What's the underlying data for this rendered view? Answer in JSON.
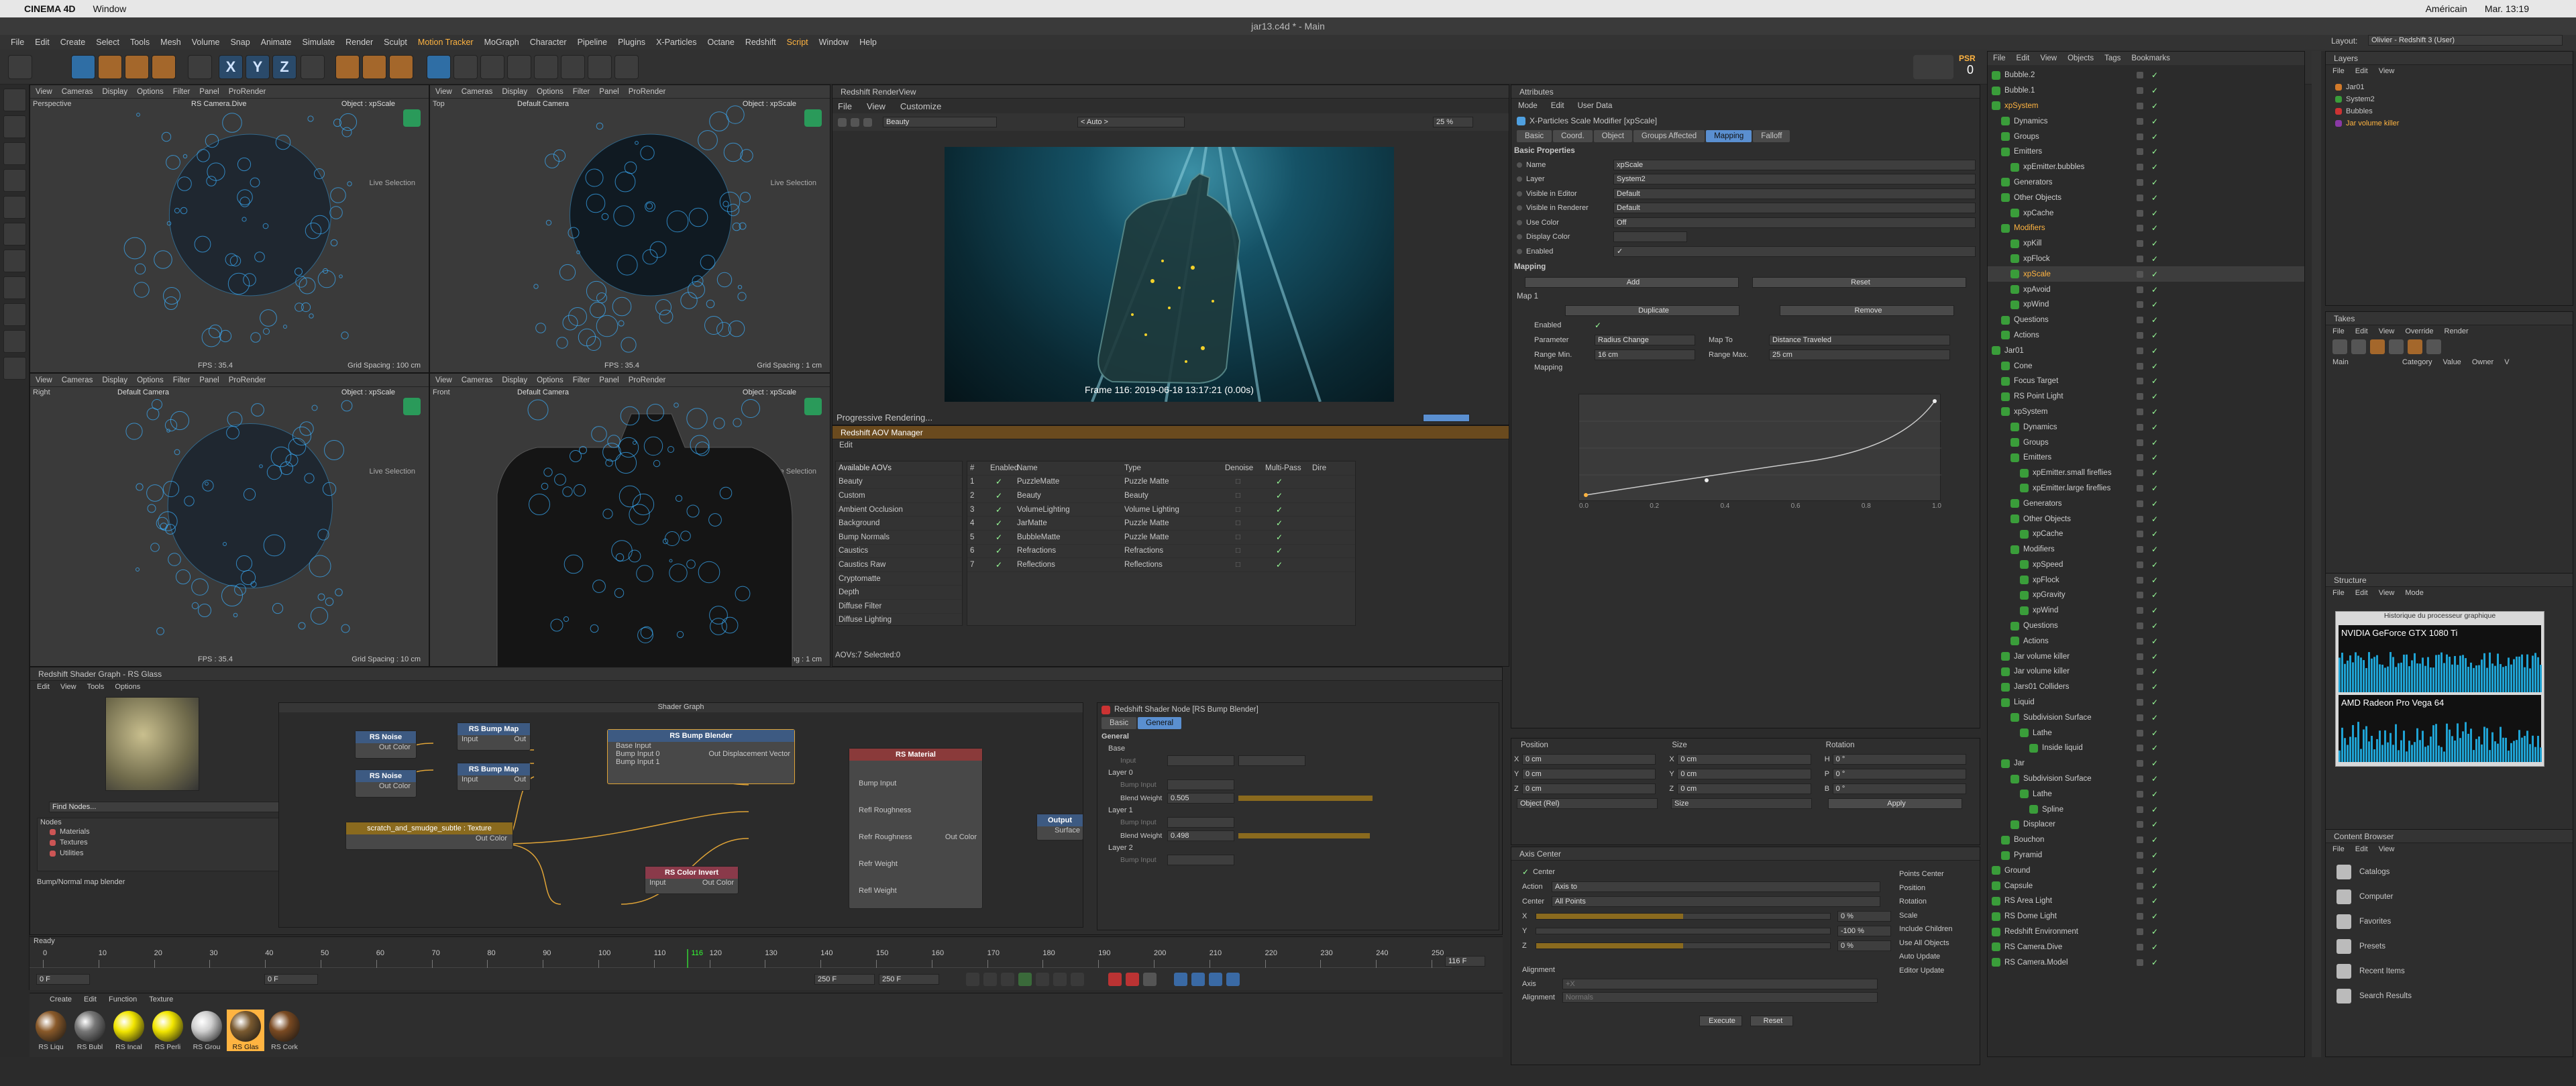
{
  "mac_menu": {
    "app": "CINEMA 4D",
    "window": "Window",
    "lang": "Américain",
    "clock": "Mar. 13:19"
  },
  "title": "jar13.c4d * - Main",
  "menus": [
    "File",
    "Edit",
    "Create",
    "Select",
    "Tools",
    "Mesh",
    "Volume",
    "Snap",
    "Animate",
    "Simulate",
    "Render",
    "Sculpt",
    "Motion Tracker",
    "MoGraph",
    "Character",
    "Pipeline",
    "Plugins",
    "X-Particles",
    "Octane",
    "Redshift",
    "Script",
    "Window",
    "Help"
  ],
  "toolbar": {
    "letters": [
      "X",
      "Y",
      "Z"
    ],
    "psr": "PSR",
    "psr_val": "0",
    "layout_label": "Layout:",
    "layout_value": "Olivier - Redshift 3 (User)"
  },
  "viewports": [
    {
      "menu": [
        "View",
        "Cameras",
        "Display",
        "Options",
        "Filter",
        "Panel",
        "ProRender"
      ],
      "name": "Perspective",
      "cam": "RS Camera.Dive",
      "object": "Object : xpScale",
      "live": "Live Selection",
      "fps": "FPS : 35.4",
      "grid": "Grid Spacing : 100 cm"
    },
    {
      "menu": [
        "View",
        "Cameras",
        "Display",
        "Options",
        "Filter",
        "Panel",
        "ProRender"
      ],
      "name": "Top",
      "cam": "Default Camera",
      "object": "Object : xpScale",
      "live": "Live Selection",
      "fps": "FPS : 35.4",
      "grid": "Grid Spacing : 1 cm"
    },
    {
      "menu": [
        "View",
        "Cameras",
        "Display",
        "Options",
        "Filter",
        "Panel",
        "ProRender"
      ],
      "name": "Right",
      "cam": "Default Camera",
      "object": "Object : xpScale",
      "live": "Live Selection",
      "fps": "FPS : 35.4",
      "grid": "Grid Spacing : 10 cm"
    },
    {
      "menu": [
        "View",
        "Cameras",
        "Display",
        "Options",
        "Filter",
        "Panel",
        "ProRender"
      ],
      "name": "Front",
      "cam": "Default Camera",
      "object": "Object : xpScale",
      "live": "Live Selection",
      "fps": "FPS : 35.4",
      "grid": "Grid Spacing : 1 cm"
    }
  ],
  "renderview": {
    "title": "Redshift RenderView",
    "menu": [
      "File",
      "View",
      "Customize"
    ],
    "aov": "Beauty",
    "auto": "< Auto >",
    "zoom": "25 %",
    "frame": "Frame  116:  2019-06-18  13:17:21  (0.00s)",
    "progress": "Progressive Rendering..."
  },
  "aov_manager": {
    "title": "Redshift AOV Manager",
    "edit": "Edit",
    "available_header": "Available AOVs",
    "available": [
      "Beauty",
      "Custom",
      "Ambient Occlusion",
      "Background",
      "Bump Normals",
      "Caustics",
      "Caustics Raw",
      "Cryptomatte",
      "Depth",
      "Diffuse Filter",
      "Diffuse Lighting"
    ],
    "columns": [
      "#",
      "Enabled",
      "Name",
      "Type",
      "Denoise",
      "Multi-Pass",
      "Dire"
    ],
    "rows": [
      {
        "n": "1",
        "name": "PuzzleMatte",
        "type": "Puzzle Matte"
      },
      {
        "n": "2",
        "name": "Beauty",
        "type": "Beauty"
      },
      {
        "n": "3",
        "name": "VolumeLighting",
        "type": "Volume Lighting"
      },
      {
        "n": "4",
        "name": "JarMatte",
        "type": "Puzzle Matte"
      },
      {
        "n": "5",
        "name": "BubbleMatte",
        "type": "Puzzle Matte"
      },
      {
        "n": "6",
        "name": "Refractions",
        "type": "Refractions"
      },
      {
        "n": "7",
        "name": "Reflections",
        "type": "Reflections"
      }
    ],
    "footer": "AOVs:7  Selected:0"
  },
  "attributes": {
    "title": "Attributes",
    "menu": [
      "Mode",
      "Edit",
      "User Data"
    ],
    "object_title": "X-Particles Scale Modifier [xpScale]",
    "tabs": [
      "Basic",
      "Coord.",
      "Object",
      "Groups Affected",
      "Mapping",
      "Falloff"
    ],
    "active_tab": "Mapping",
    "basic_header": "Basic Properties",
    "fields": [
      {
        "label": "Name",
        "value": "xpScale"
      },
      {
        "label": "Layer",
        "value": "System2"
      },
      {
        "label": "Visible in Editor",
        "value": "Default"
      },
      {
        "label": "Visible in Renderer",
        "value": "Default"
      },
      {
        "label": "Use Color",
        "value": "Off"
      },
      {
        "label": "Display Color",
        "value": ""
      },
      {
        "label": "Enabled",
        "value": "✓"
      }
    ],
    "mapping_header": "Mapping",
    "add": "Add",
    "reset": "Reset",
    "map_header": "Map 1",
    "duplicate": "Duplicate",
    "remove": "Remove",
    "map_enabled": "Enabled",
    "parameter_label": "Parameter",
    "parameter_value": "Radius Change",
    "mapto_label": "Map To",
    "mapto_value": "Distance Traveled",
    "rangemin_label": "Range Min.",
    "rangemin_value": "16 cm",
    "rangemax_label": "Range Max.",
    "rangemax_value": "25 cm",
    "mapping_label": "Mapping",
    "graph_ticks": [
      "0.0",
      "0.2",
      "0.4",
      "0.6",
      "0.8",
      "1.0"
    ]
  },
  "coords": {
    "headers": [
      "Position",
      "Size",
      "Rotation"
    ],
    "rows": [
      {
        "a": "X",
        "p": "0 cm",
        "b": "X",
        "s": "0 cm",
        "c": "H",
        "r": "0 °"
      },
      {
        "a": "Y",
        "p": "0 cm",
        "b": "Y",
        "s": "0 cm",
        "c": "P",
        "r": "0 °"
      },
      {
        "a": "Z",
        "p": "0 cm",
        "b": "Z",
        "s": "0 cm",
        "c": "B",
        "r": "0 °"
      }
    ],
    "mode": "Object (Rel)",
    "size_mode": "Size",
    "apply": "Apply"
  },
  "axis_center": {
    "title": "Axis Center",
    "center": "Center",
    "action_label": "Action",
    "action_value": "Axis to",
    "center_label": "Center",
    "center_value": "All Points",
    "x": "X",
    "y": "Y",
    "z": "Z",
    "xv": "0 %",
    "yv": "-100 %",
    "zv": "0 %",
    "right": [
      "Points Center",
      "Position",
      "Rotation",
      "Scale",
      "Include Children",
      "Use All Objects",
      "Auto Update",
      "Editor Update"
    ],
    "alignment": "Alignment",
    "axis": "Axis",
    "axis_value": "+X",
    "align_label": "Alignment",
    "align_value": "Normals",
    "execute": "Execute",
    "reset": "Reset"
  },
  "objects": {
    "menu": [
      "File",
      "Edit",
      "View",
      "Objects",
      "Tags",
      "Bookmarks"
    ],
    "items": [
      {
        "t": "Bubble.2",
        "i": 0
      },
      {
        "t": "Bubble.1",
        "i": 0
      },
      {
        "t": "xpSystem",
        "i": 0,
        "hl": true
      },
      {
        "t": "Dynamics",
        "i": 1
      },
      {
        "t": "Groups",
        "i": 1
      },
      {
        "t": "Emitters",
        "i": 1
      },
      {
        "t": "xpEmitter.bubbles",
        "i": 2
      },
      {
        "t": "Generators",
        "i": 1
      },
      {
        "t": "Other Objects",
        "i": 1
      },
      {
        "t": "xpCache",
        "i": 2
      },
      {
        "t": "Modifiers",
        "i": 1,
        "hl": true
      },
      {
        "t": "xpKill",
        "i": 2
      },
      {
        "t": "xpFlock",
        "i": 2
      },
      {
        "t": "xpScale",
        "i": 2,
        "sel": true
      },
      {
        "t": "xpAvoid",
        "i": 2
      },
      {
        "t": "xpWind",
        "i": 2
      },
      {
        "t": "Questions",
        "i": 1
      },
      {
        "t": "Actions",
        "i": 1
      },
      {
        "t": "Jar01",
        "i": 0
      },
      {
        "t": "Cone",
        "i": 1
      },
      {
        "t": "Focus Target",
        "i": 1
      },
      {
        "t": "RS Point Light",
        "i": 1
      },
      {
        "t": "xpSystem",
        "i": 1
      },
      {
        "t": "Dynamics",
        "i": 2
      },
      {
        "t": "Groups",
        "i": 2
      },
      {
        "t": "Emitters",
        "i": 2
      },
      {
        "t": "xpEmitter.small fireflies",
        "i": 3
      },
      {
        "t": "xpEmitter.large fireflies",
        "i": 3
      },
      {
        "t": "Generators",
        "i": 2
      },
      {
        "t": "Other Objects",
        "i": 2
      },
      {
        "t": "xpCache",
        "i": 3
      },
      {
        "t": "Modifiers",
        "i": 2
      },
      {
        "t": "xpSpeed",
        "i": 3
      },
      {
        "t": "xpFlock",
        "i": 3
      },
      {
        "t": "xpGravity",
        "i": 3
      },
      {
        "t": "xpWind",
        "i": 3
      },
      {
        "t": "Questions",
        "i": 2
      },
      {
        "t": "Actions",
        "i": 2
      },
      {
        "t": "Jar volume killer",
        "i": 1
      },
      {
        "t": "Jar volume killer",
        "i": 1
      },
      {
        "t": "Jars01 Colliders",
        "i": 1
      },
      {
        "t": "Liquid",
        "i": 1
      },
      {
        "t": "Subdivision Surface",
        "i": 2
      },
      {
        "t": "Lathe",
        "i": 3
      },
      {
        "t": "Inside liquid",
        "i": 4
      },
      {
        "t": "Jar",
        "i": 1
      },
      {
        "t": "Subdivision Surface",
        "i": 2
      },
      {
        "t": "Lathe",
        "i": 3
      },
      {
        "t": "Spline",
        "i": 4
      },
      {
        "t": "Displacer",
        "i": 2
      },
      {
        "t": "Bouchon",
        "i": 1
      },
      {
        "t": "Pyramid",
        "i": 1
      },
      {
        "t": "Ground",
        "i": 0
      },
      {
        "t": "Capsule",
        "i": 0
      },
      {
        "t": "RS Area Light",
        "i": 0
      },
      {
        "t": "RS Dome Light",
        "i": 0
      },
      {
        "t": "Redshift Environment",
        "i": 0
      },
      {
        "t": "RS Camera.Dive",
        "i": 0
      },
      {
        "t": "RS Camera.Model",
        "i": 0
      }
    ]
  },
  "layers": {
    "title": "Layers",
    "menu": [
      "File",
      "Edit",
      "View"
    ],
    "items": [
      "Jar01",
      "System2",
      "Bubbles",
      "Jar volume killer"
    ]
  },
  "takes": {
    "title": "Takes",
    "menu": [
      "File",
      "Edit",
      "View",
      "Override",
      "Render"
    ],
    "cols": [
      "Main",
      "Category",
      "Value",
      "Owner",
      "V"
    ]
  },
  "structure": {
    "title": "Structure",
    "menu": [
      "File",
      "Edit",
      "View",
      "Mode"
    ],
    "gpu_title": "Historique du processeur graphique",
    "gpu1": "NVIDIA GeForce GTX 1080 Ti",
    "gpu2": "AMD Radeon Pro Vega 64"
  },
  "content_browser": {
    "title": "Content Browser",
    "menu": [
      "File",
      "Edit",
      "View"
    ],
    "items": [
      "Catalogs",
      "Computer",
      "Favorites",
      "Presets",
      "Recent Items",
      "Search Results"
    ]
  },
  "shader_graph": {
    "title": "Redshift Shader Graph - RS Glass",
    "menu": [
      "Edit",
      "View",
      "Tools",
      "Options"
    ],
    "graph_title": "Shader Graph",
    "find": "Find Nodes...",
    "tree_header": "Nodes",
    "tree": [
      "Materials",
      "Textures",
      "Utilities"
    ],
    "desc": "Bump/Normal map blender",
    "nodes": {
      "noise1": "RS Noise",
      "noise2": "RS Noise",
      "bump1": "RS Bump Map",
      "bump2": "RS Bump Map",
      "blender": "RS Bump Blender",
      "material": "RS Material",
      "texture": "scratch_and_smudge_subtle : Texture",
      "invert": "RS Color Invert",
      "output": "Output"
    },
    "ports": {
      "out_color": "Out Color",
      "input": "Input",
      "base_input": "Base Input",
      "bump0": "Bump Input 0",
      "bump1": "Bump Input 1",
      "out_disp": "Out Displacement Vector",
      "bump_input": "Bump Input",
      "refl_rough": "Refl Roughness",
      "refr_rough": "Refr Roughness",
      "refr_weight": "Refr Weight",
      "refl_weight": "Refl Weight",
      "surface": "Surface"
    }
  },
  "node_props": {
    "title": "Redshift Shader Node [RS Bump Blender]",
    "tabs": [
      "Basic",
      "General"
    ],
    "section": "General",
    "base": "Base",
    "input": "Input",
    "layer0": "Layer 0",
    "layer1": "Layer 1",
    "layer2": "Layer 2",
    "bump_input": "Bump Input",
    "blend_weight": "Blend Weight",
    "bw0": "0.505",
    "bw1": "0.498"
  },
  "timeline": {
    "ready": "Ready",
    "ticks": [
      "0",
      "10",
      "20",
      "30",
      "40",
      "50",
      "60",
      "70",
      "80",
      "90",
      "100",
      "110",
      "120",
      "130",
      "140",
      "150",
      "160",
      "170",
      "180",
      "190",
      "200",
      "210",
      "220",
      "230",
      "240",
      "250"
    ],
    "current": "116",
    "cur_field": "116 F",
    "start": "0 F",
    "end": "250 F",
    "field2": "0 F",
    "field3": "250 F",
    "playhead": 0.464
  },
  "materials": {
    "menu": [
      "Create",
      "Edit",
      "Function",
      "Texture"
    ],
    "items": [
      {
        "n": "RS Liqu",
        "c": "#8a5a2a"
      },
      {
        "n": "RS Bubl",
        "c": "#777777"
      },
      {
        "n": "RS Incal",
        "c": "#f2e600"
      },
      {
        "n": "RS Perli",
        "c": "#f2e600"
      },
      {
        "n": "RS Grou",
        "c": "#cfcfcf"
      },
      {
        "n": "RS Glas",
        "c": "#7a5a30",
        "sel": true
      },
      {
        "n": "RS Cork",
        "c": "#7a4a22"
      }
    ]
  }
}
